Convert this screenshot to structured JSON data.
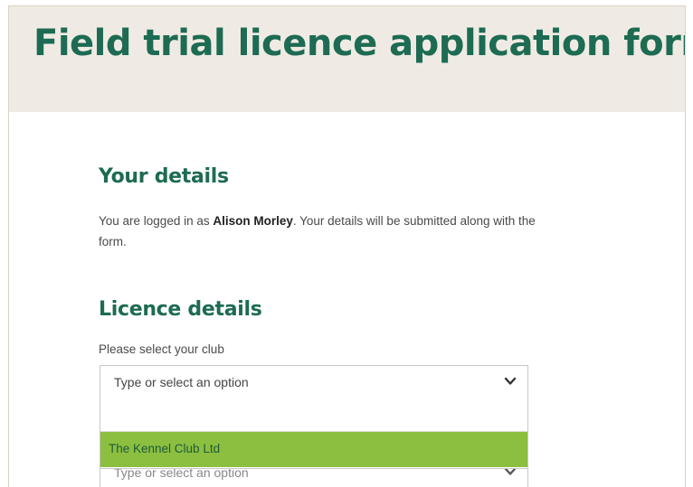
{
  "header": {
    "title": "Field trial licence application form"
  },
  "your_details": {
    "heading": "Your details",
    "text_before": "You are logged in as ",
    "user_name": "Alison Morley",
    "text_after": ". Your details will be submitted along with the form."
  },
  "licence_details": {
    "heading": "Licence details",
    "club_label": "Please select your club",
    "club_select": {
      "placeholder": "Type or select an option",
      "icon": "chevron-down-icon"
    },
    "dropdown": {
      "search_value": "",
      "options": [
        "The Kennel Club Ltd"
      ],
      "highlight_color": "#8cbf3f"
    },
    "next_select": {
      "placeholder": "Type or select an option",
      "icon": "chevron-down-icon"
    }
  },
  "colors": {
    "brand_green": "#1d6b52",
    "banner_bg": "#efebe4"
  }
}
